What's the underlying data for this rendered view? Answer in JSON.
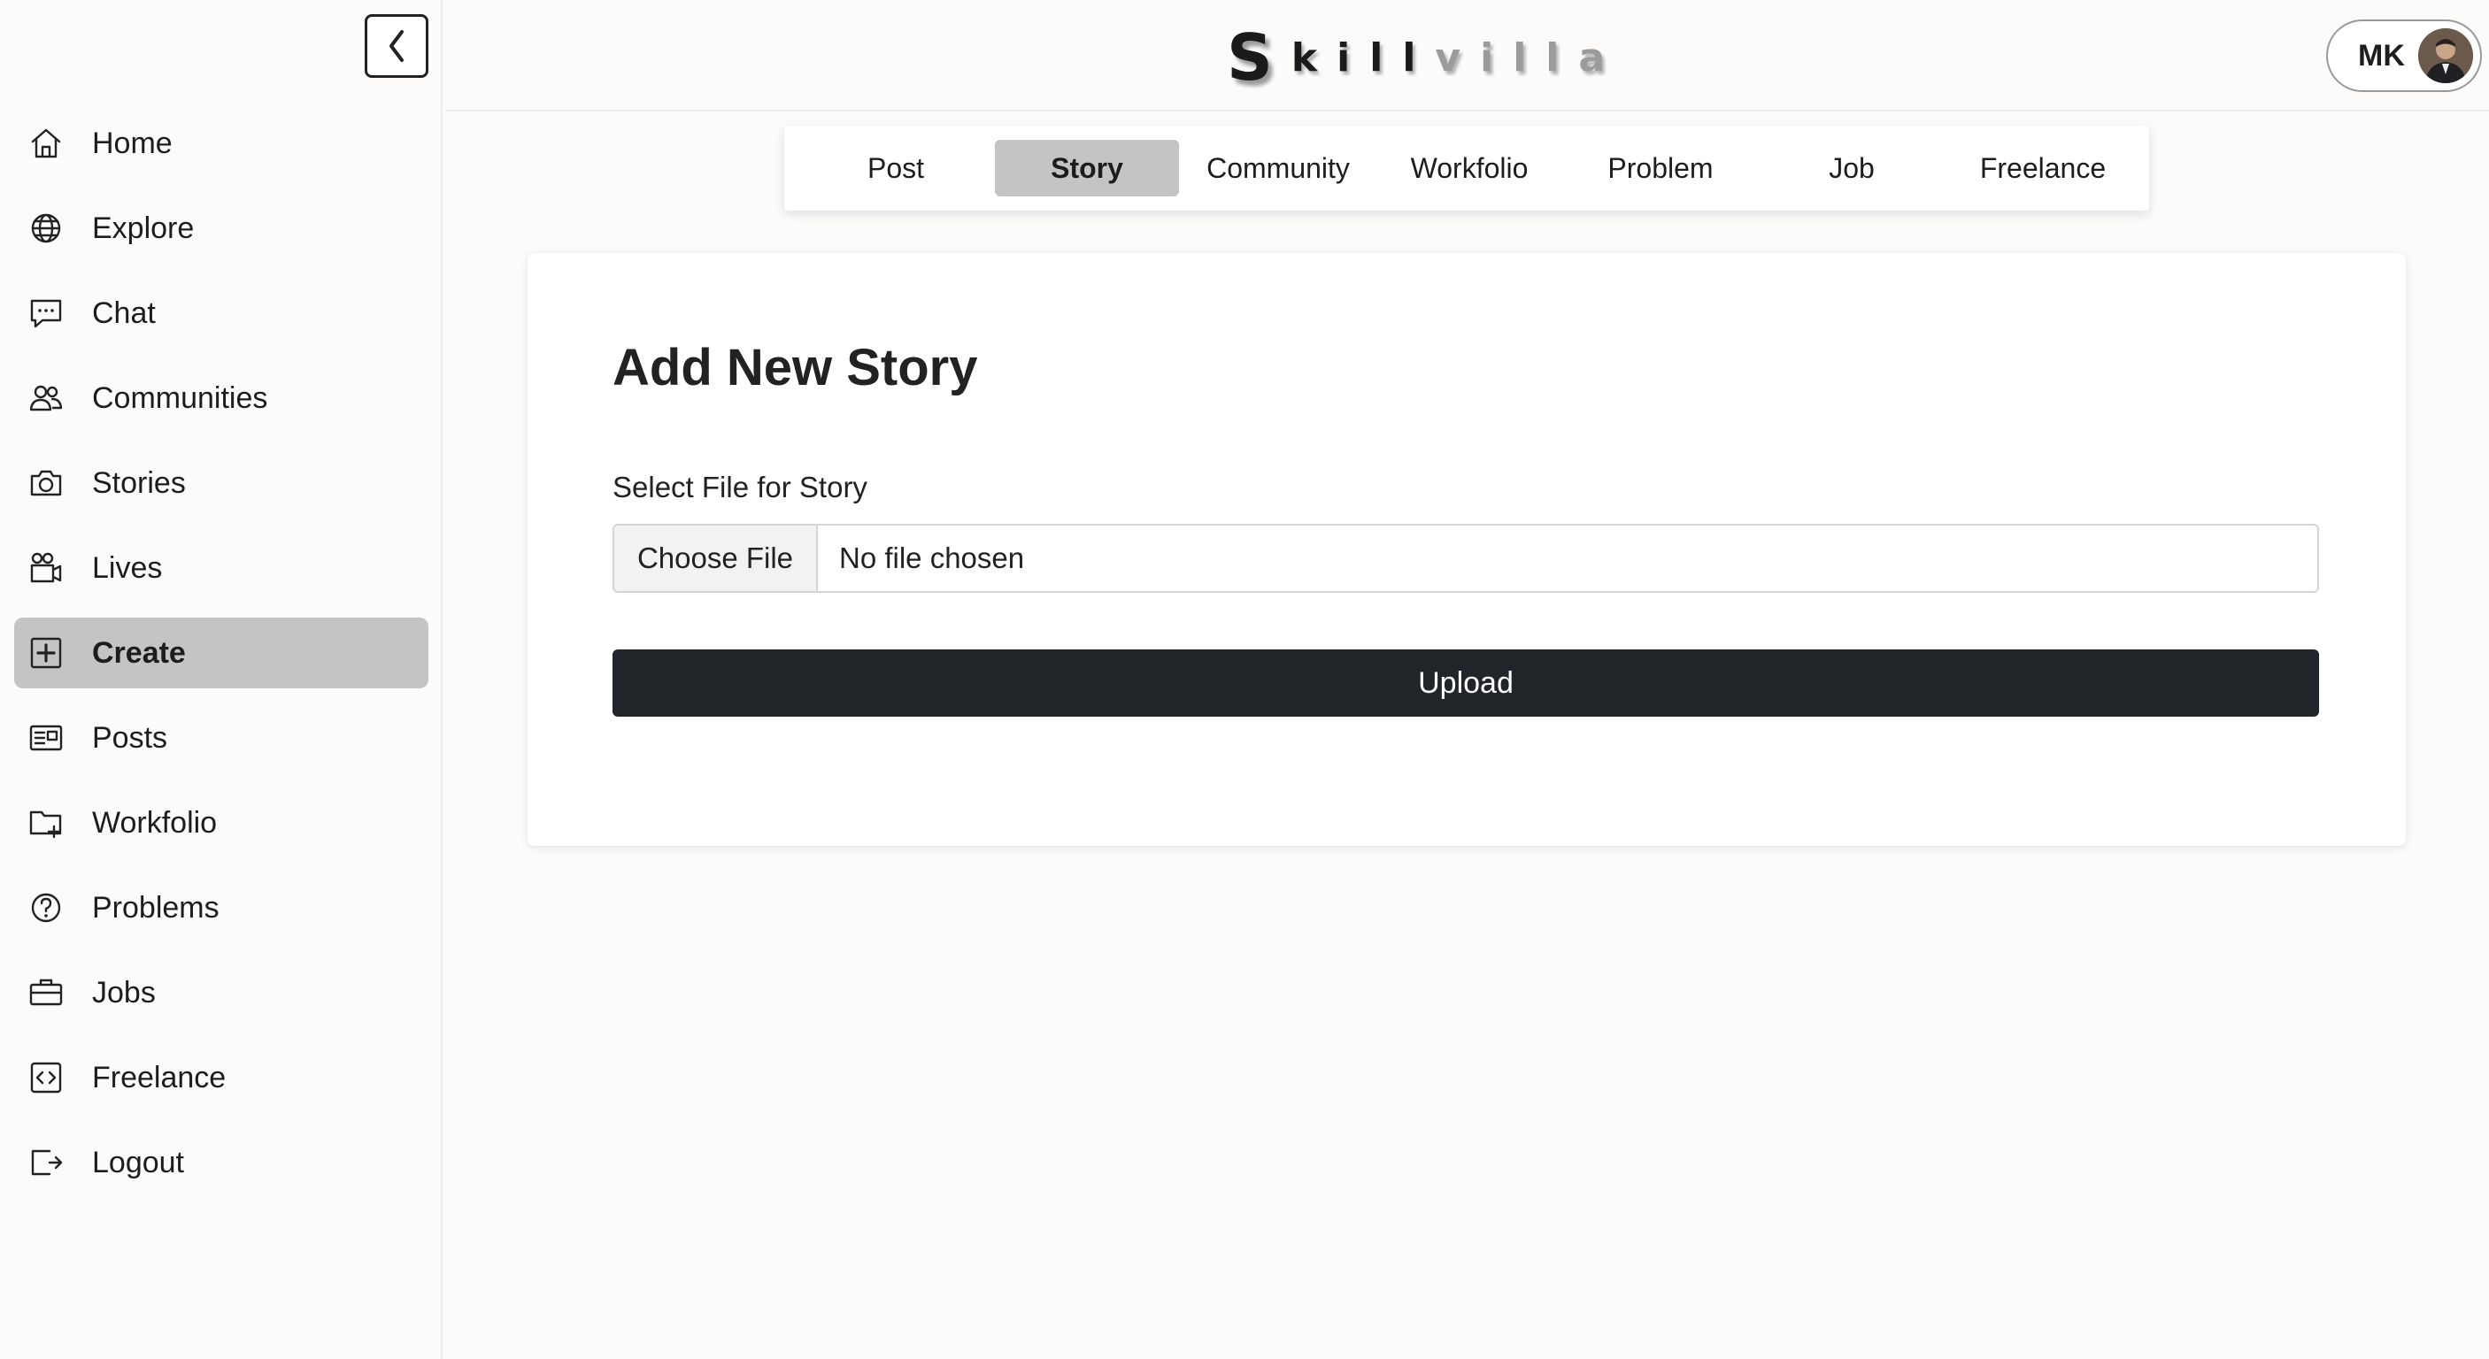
{
  "brand": {
    "first": "S",
    "letters": [
      {
        "ch": "k",
        "color": "#1a1a1a"
      },
      {
        "ch": "i",
        "color": "#1a1a1a"
      },
      {
        "ch": "l",
        "color": "#1a1a1a"
      },
      {
        "ch": "l",
        "color": "#1a1a1a"
      },
      {
        "ch": "v",
        "color": "#9b9b9b"
      },
      {
        "ch": "i",
        "color": "#9b9b9b"
      },
      {
        "ch": "l",
        "color": "#9b9b9b"
      },
      {
        "ch": "l",
        "color": "#9b9b9b"
      },
      {
        "ch": "a",
        "color": "#9b9b9b"
      }
    ]
  },
  "profile": {
    "initials": "MK"
  },
  "sidebar": {
    "items": [
      {
        "label": "Home",
        "icon": "home-icon",
        "active": false
      },
      {
        "label": "Explore",
        "icon": "globe-icon",
        "active": false
      },
      {
        "label": "Chat",
        "icon": "chat-icon",
        "active": false
      },
      {
        "label": "Communities",
        "icon": "users-icon",
        "active": false
      },
      {
        "label": "Stories",
        "icon": "camera-icon",
        "active": false
      },
      {
        "label": "Lives",
        "icon": "video-icon",
        "active": false
      },
      {
        "label": "Create",
        "icon": "plus-square-icon",
        "active": true
      },
      {
        "label": "Posts",
        "icon": "newspaper-icon",
        "active": false
      },
      {
        "label": "Workfolio",
        "icon": "folder-plus-icon",
        "active": false
      },
      {
        "label": "Problems",
        "icon": "question-icon",
        "active": false
      },
      {
        "label": "Jobs",
        "icon": "briefcase-icon",
        "active": false
      },
      {
        "label": "Freelance",
        "icon": "code-icon",
        "active": false
      },
      {
        "label": "Logout",
        "icon": "logout-icon",
        "active": false
      }
    ]
  },
  "tabs": [
    {
      "label": "Post",
      "active": false
    },
    {
      "label": "Story",
      "active": true
    },
    {
      "label": "Community",
      "active": false
    },
    {
      "label": "Workfolio",
      "active": false
    },
    {
      "label": "Problem",
      "active": false
    },
    {
      "label": "Job",
      "active": false
    },
    {
      "label": "Freelance",
      "active": false
    }
  ],
  "form": {
    "title": "Add New Story",
    "file_label": "Select File for Story",
    "choose_label": "Choose File",
    "file_status": "No file chosen",
    "upload_label": "Upload"
  },
  "colors": {
    "active_bg": "#c4c4c4",
    "upload_bg": "#212529"
  }
}
